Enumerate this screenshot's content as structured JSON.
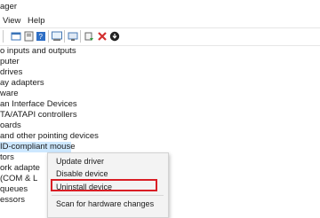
{
  "window": {
    "title": "ager"
  },
  "menu": {
    "view": "View",
    "help": "Help"
  },
  "toolbar": {
    "icons": [
      "back-icon",
      "forward-icon",
      "properties-icon",
      "help-icon",
      "show-hidden-icon",
      "computer-icon",
      "update-driver-icon",
      "uninstall-icon",
      "download-icon"
    ]
  },
  "tree": {
    "items": [
      "o inputs and outputs",
      "puter",
      "drives",
      "ay adapters",
      "ware",
      "an Interface Devices",
      "TA/ATAPI controllers",
      "oards",
      "and other pointing devices",
      "ID-compliant mouse",
      "tors",
      "ork adapte",
      "(COM & L",
      "queues",
      "essors"
    ]
  },
  "context_menu": {
    "update": "Update driver",
    "disable": "Disable device",
    "uninstall": "Uninstall device",
    "scan": "Scan for hardware changes"
  },
  "colors": {
    "selection": "#cde8ff",
    "highlight_border": "#d91e25",
    "uninstall_icon": "#d32f2f",
    "download_icon": "#222222"
  }
}
